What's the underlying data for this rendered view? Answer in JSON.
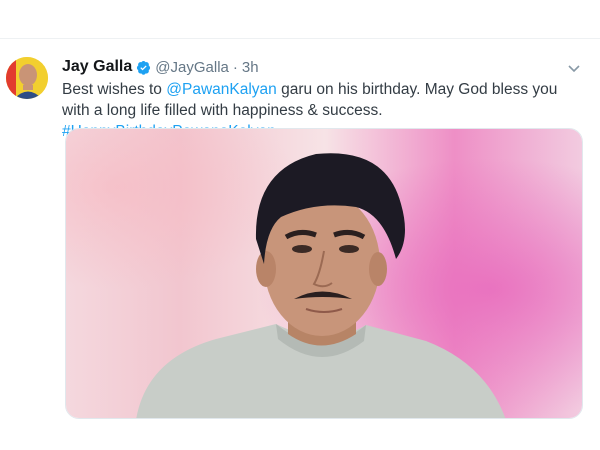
{
  "tweet": {
    "author_name": "Jay Galla",
    "author_handle": "@JayGalla",
    "separator": "·",
    "time": "3h",
    "text_part1": "Best wishes to ",
    "mention": "@PawanKalyan",
    "text_part2": " garu on his birthday. May God bless you with a long life filled with happiness & success. ",
    "hashtag": "#HappyBirthdayPawanaKalyan"
  },
  "icons": {
    "verified": "verified-badge-icon",
    "caret": "chevron-down-icon"
  },
  "colors": {
    "link": "#1da1f2",
    "verified": "#1da1f2",
    "text": "#14171a",
    "muted": "#657786"
  }
}
